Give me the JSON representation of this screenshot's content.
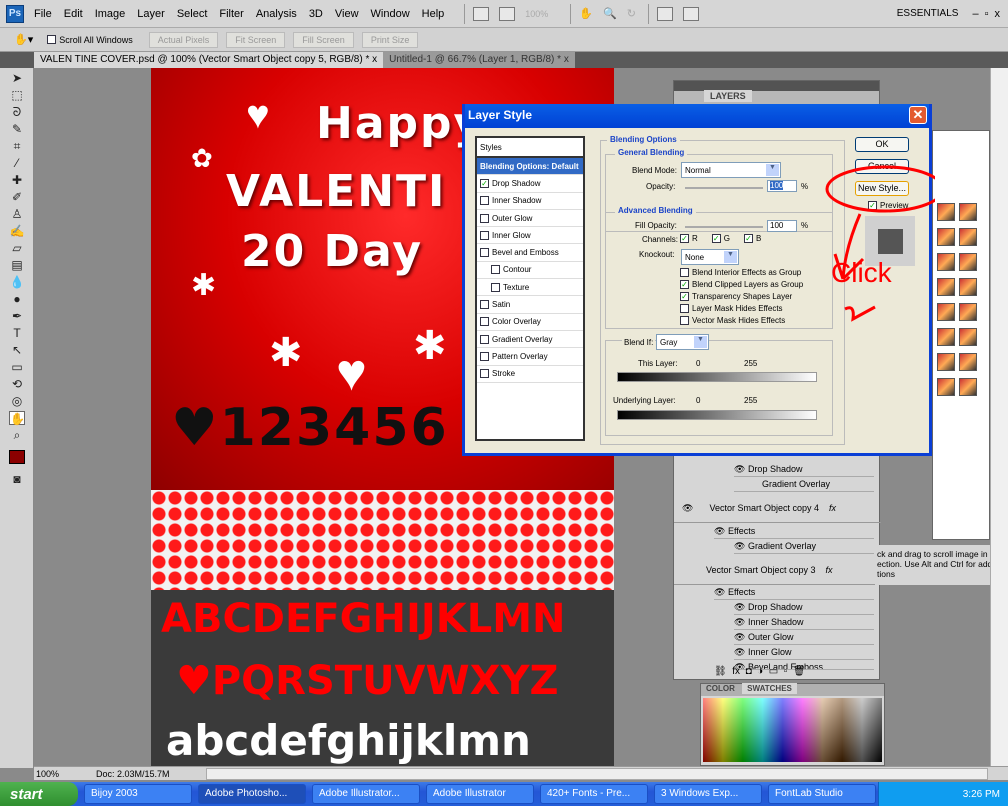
{
  "app": {
    "logo": "Ps",
    "menu": [
      "File",
      "Edit",
      "Image",
      "Layer",
      "Select",
      "Filter",
      "Analysis",
      "3D",
      "View",
      "Window",
      "Help"
    ],
    "zoom_display": "100%",
    "workspace": "ESSENTIALS",
    "window_controls": [
      "–",
      "▫",
      "x"
    ]
  },
  "options": {
    "scroll_all_windows": "Scroll All Windows",
    "buttons": [
      "Actual Pixels",
      "Fit Screen",
      "Fill Screen",
      "Print Size"
    ]
  },
  "doc_tabs": [
    {
      "label": "VALEN TINE COVER.psd @ 100% (Vector Smart Object copy 5, RGB/8) *",
      "close": "x"
    },
    {
      "label": "Untitled-1 @ 66.7% (Layer 1, RGB/8) *",
      "close": "x"
    }
  ],
  "artwork": {
    "line1": "Happy",
    "line2": "VALENTI",
    "line3": "20 Day",
    "numbers": "♥123456",
    "upper1": "ABCDEFGHIJKLMN",
    "upper2": "♥PQRSTUVWXYZ",
    "lower": "abcdefghijklmn"
  },
  "status": {
    "zoom": "100%",
    "doc": "Doc: 2.03M/15.7M"
  },
  "layers_panel": {
    "tab": "LAYERS",
    "rows": [
      {
        "type": "effect",
        "label": "Drop Shadow"
      },
      {
        "type": "effect",
        "label": "Gradient Overlay"
      },
      {
        "type": "layer",
        "label": "Vector Smart Object copy 4",
        "fx": "fx"
      },
      {
        "type": "effects",
        "label": "Effects"
      },
      {
        "type": "effect",
        "label": "Gradient Overlay"
      },
      {
        "type": "layer",
        "label": "Vector Smart Object copy 3",
        "fx": "fx"
      },
      {
        "type": "effects",
        "label": "Effects"
      },
      {
        "type": "effect",
        "label": "Drop Shadow"
      },
      {
        "type": "effect",
        "label": "Inner Shadow"
      },
      {
        "type": "effect",
        "label": "Outer Glow"
      },
      {
        "type": "effect",
        "label": "Inner Glow"
      },
      {
        "type": "effect",
        "label": "Bevel and Emboss"
      }
    ]
  },
  "help_text": [
    "ck and drag to scroll image in desi",
    "ection.  Use Alt and Ctrl for additio",
    "tions"
  ],
  "color_panel": {
    "tabs": [
      "COLOR",
      "SWATCHES"
    ]
  },
  "dialog": {
    "title": "Layer Style",
    "close": "✕",
    "styles_header": "Styles",
    "styles": [
      {
        "label": "Blending Options: Default",
        "selected": true
      },
      {
        "label": "Drop Shadow",
        "checked": true
      },
      {
        "label": "Inner Shadow",
        "checked": false
      },
      {
        "label": "Outer Glow",
        "checked": false
      },
      {
        "label": "Inner Glow",
        "checked": false
      },
      {
        "label": "Bevel and Emboss",
        "checked": false
      },
      {
        "label": "Contour",
        "checked": false,
        "indent": true
      },
      {
        "label": "Texture",
        "checked": false,
        "indent": true
      },
      {
        "label": "Satin",
        "checked": false
      },
      {
        "label": "Color Overlay",
        "checked": false
      },
      {
        "label": "Gradient Overlay",
        "checked": false
      },
      {
        "label": "Pattern Overlay",
        "checked": false
      },
      {
        "label": "Stroke",
        "checked": false
      }
    ],
    "blending_options": "Blending Options",
    "general_blending": "General Blending",
    "blend_mode_label": "Blend Mode:",
    "blend_mode": "Normal",
    "opacity_label": "Opacity:",
    "opacity": "100",
    "percent": "%",
    "advanced_blending": "Advanced Blending",
    "fill_opacity_label": "Fill Opacity:",
    "fill_opacity": "100",
    "channels_label": "Channels:",
    "channels": [
      "R",
      "G",
      "B"
    ],
    "knockout_label": "Knockout:",
    "knockout": "None",
    "options": [
      {
        "label": "Blend Interior Effects as Group",
        "checked": false
      },
      {
        "label": "Blend Clipped Layers as Group",
        "checked": true
      },
      {
        "label": "Transparency Shapes Layer",
        "checked": true
      },
      {
        "label": "Layer Mask Hides Effects",
        "checked": false
      },
      {
        "label": "Vector Mask Hides Effects",
        "checked": false
      }
    ],
    "blend_if_label": "Blend If:",
    "blend_if": "Gray",
    "this_layer": "This Layer:",
    "underlying_layer": "Underlying Layer:",
    "range_min": "0",
    "range_max": "255",
    "ok": "OK",
    "cancel": "Cancel",
    "new_style": "New Style...",
    "preview": "Preview"
  },
  "annotation": {
    "text": "Click",
    "number": "2",
    "color": "#ff0000"
  },
  "taskbar": {
    "start": "start",
    "tasks": [
      "Bijoy 2003",
      "Adobe Photosho...",
      "Adobe Illustrator...",
      "Adobe Illustrator",
      "420+ Fonts - Pre...",
      "3 Windows Exp...",
      "FontLab Studio"
    ],
    "active": 1,
    "clock": "3:26 PM"
  }
}
